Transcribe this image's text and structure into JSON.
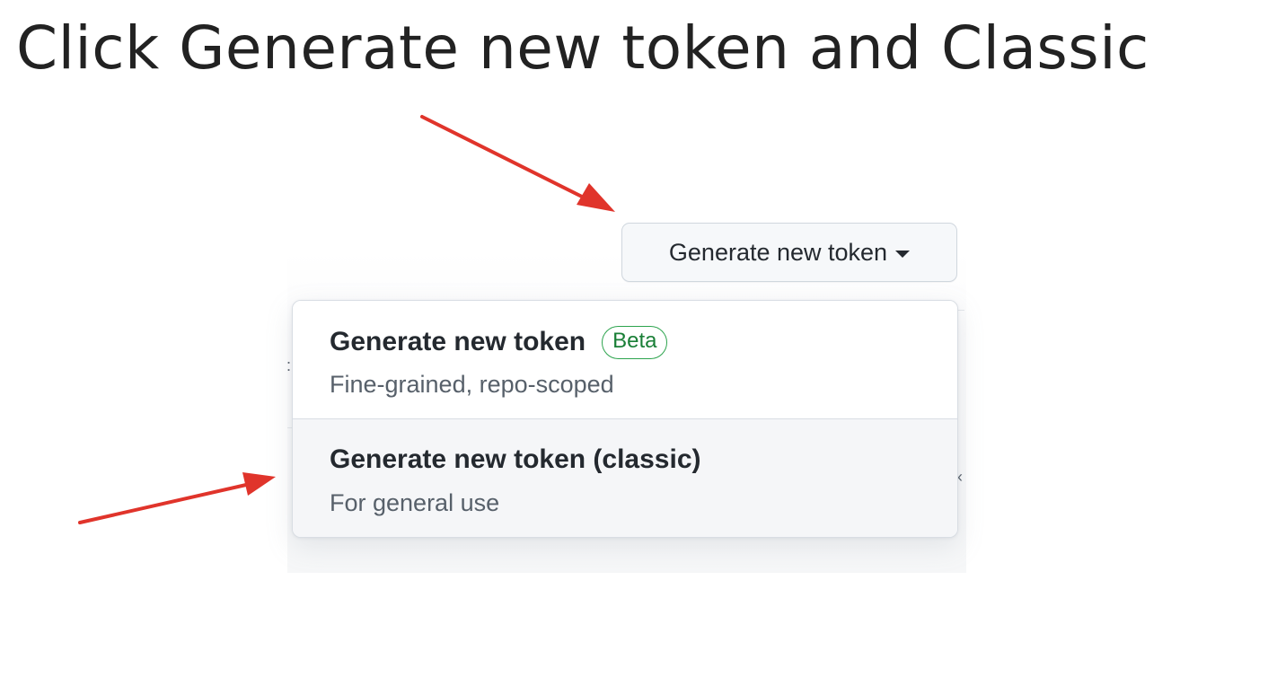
{
  "instruction": {
    "title": "Click Generate new token and Classic"
  },
  "toolbar": {
    "generate_button_label": "Generate new token"
  },
  "menu": {
    "items": [
      {
        "title": "Generate new token",
        "badge": "Beta",
        "description": "Fine-grained, repo-scoped"
      },
      {
        "title": "Generate new token (classic)",
        "description": "For general use"
      }
    ]
  },
  "colors": {
    "arrow": "#e0342b",
    "badge_green": "#1a7f37",
    "highlight_bg": "#f5f6f8"
  },
  "icons": {
    "button_caret": "chevron-down-icon"
  }
}
